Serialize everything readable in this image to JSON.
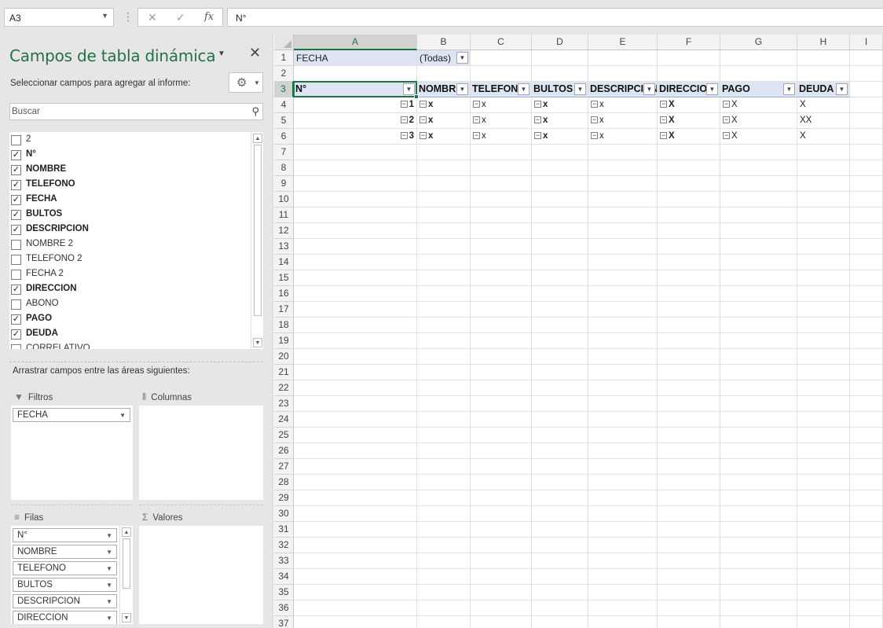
{
  "formula_bar": {
    "name_box": "A3",
    "cancel_icon": "✕",
    "enter_icon": "✓",
    "fx_label": "fx",
    "content": "N°"
  },
  "pivot_pane": {
    "title": "Campos de tabla dinámica",
    "subtitle": "Seleccionar campos para agregar al informe:",
    "search_placeholder": "Buscar",
    "fields": [
      {
        "label": "2",
        "checked": false
      },
      {
        "label": "N°",
        "checked": true
      },
      {
        "label": "NOMBRE",
        "checked": true
      },
      {
        "label": "TELEFONO",
        "checked": true
      },
      {
        "label": "FECHA",
        "checked": true
      },
      {
        "label": "BULTOS",
        "checked": true
      },
      {
        "label": "DESCRIPCION",
        "checked": true
      },
      {
        "label": "NOMBRE 2",
        "checked": false
      },
      {
        "label": "TELEFONO 2",
        "checked": false
      },
      {
        "label": "FECHA 2",
        "checked": false
      },
      {
        "label": "DIRECCION",
        "checked": true
      },
      {
        "label": "ABONO",
        "checked": false
      },
      {
        "label": "PAGO",
        "checked": true
      },
      {
        "label": "DEUDA",
        "checked": true
      },
      {
        "label": "CORRELATIVO",
        "checked": false
      }
    ],
    "drag_hint": "Arrastrar campos entre las áreas siguientes:",
    "areas": {
      "filters": {
        "label": "Filtros",
        "items": [
          "FECHA"
        ]
      },
      "columns": {
        "label": "Columnas",
        "items": []
      },
      "rows": {
        "label": "Filas",
        "items": [
          "N°",
          "NOMBRE",
          "TELEFONO",
          "BULTOS",
          "DESCRIPCION",
          "DIRECCION"
        ]
      },
      "values": {
        "label": "Valores",
        "items": []
      }
    }
  },
  "sheet": {
    "columns": [
      "A",
      "B",
      "C",
      "D",
      "E",
      "F",
      "G",
      "H",
      "I"
    ],
    "selected_column": "A",
    "selected_row": 3,
    "row_count": 37,
    "filter_row": {
      "field": "FECHA",
      "value": "(Todas)"
    },
    "pivot_headers": [
      "N°",
      "NOMBRE",
      "TELEFONO",
      "BULTOS",
      "DESCRIPCION",
      "DIRECCION",
      "PAGO",
      "DEUDA"
    ],
    "pivot_rows": [
      {
        "n": "1",
        "nombre": "x",
        "telefono": "x",
        "bultos": "x",
        "descripcion": "x",
        "direccion": "X",
        "pago": "X",
        "deuda": "X"
      },
      {
        "n": "2",
        "nombre": "x",
        "telefono": "x",
        "bultos": "x",
        "descripcion": "x",
        "direccion": "X",
        "pago": "X",
        "deuda": "XX"
      },
      {
        "n": "3",
        "nombre": "x",
        "telefono": "x",
        "bultos": "x",
        "descripcion": "x",
        "direccion": "X",
        "pago": "X",
        "deuda": "X"
      }
    ]
  },
  "colors": {
    "accent": "#217346",
    "pivot_header_bg": "#dde4f2",
    "pane_bg": "#e6e6e6"
  }
}
